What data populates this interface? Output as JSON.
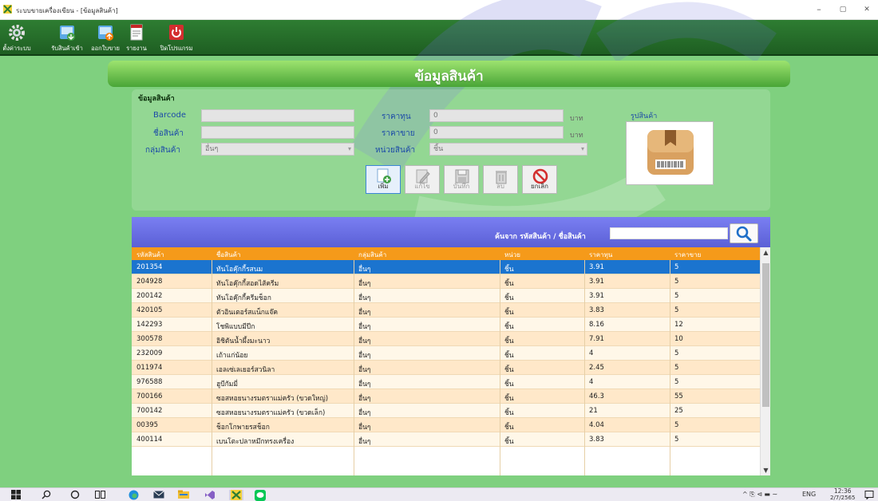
{
  "window": {
    "title": "ระบบขายเครื่องเขียน - [ข้อมูลสินค้า]",
    "minimize": "–",
    "maximize": "▢",
    "close": "✕"
  },
  "toolbar": [
    {
      "label": "ตั้งค่าระบบ",
      "icon": "gear-icon"
    },
    {
      "label": "รับสินค้าเข้า",
      "icon": "receive-goods-icon"
    },
    {
      "label": "ออกใบขาย",
      "icon": "invoice-icon"
    },
    {
      "label": "รายงาน",
      "icon": "report-icon"
    },
    {
      "label": "ปิดโปรแกรม",
      "icon": "power-icon"
    }
  ],
  "page_title": "ข้อมูลสินค้า",
  "form": {
    "section_label": "ข้อมูลสินค้า",
    "barcode_label": "Barcode",
    "barcode_value": "",
    "name_label": "ชื่อสินค้า",
    "name_value": "",
    "group_label": "กลุ่มสินค้า",
    "group_value": "อื่นๆ",
    "cost_label": "ราคาทุน",
    "cost_value": "0",
    "cost_unit": "บาท",
    "price_label": "ราคาขาย",
    "price_value": "0",
    "price_unit": "บาท",
    "unit_label": "หน่วยสินค้า",
    "unit_value": "ชิ้น",
    "photo_label": "รูปสินค้า"
  },
  "actions": {
    "add": "เพิ่ม",
    "edit": "แก้ไข",
    "save": "บันทึก",
    "delete": "ลบ",
    "cancel": "ยกเลิก"
  },
  "search": {
    "label": "ค้นจาก รหัสสินค้า / ชื่อสินค้า",
    "value": ""
  },
  "table": {
    "headers": [
      "รหัสสินค้า",
      "ชื่อสินค้า",
      "กลุ่มสินค้า",
      "หน่วย",
      "ราคาทุน",
      "ราคาขาย"
    ],
    "rows": [
      [
        "201354",
        "ทันโอคุ๊กกี้รสนม",
        "อื่นๆ",
        "ชิ้น",
        "3.91",
        "5"
      ],
      [
        "204928",
        "ทันโอคุ๊กกี้สอดไส้ครีม",
        "อื่นๆ",
        "ชิ้น",
        "3.91",
        "5"
      ],
      [
        "200142",
        "ทันโอคุ๊กกี้ครีมช็อก",
        "อื่นๆ",
        "ชิ้น",
        "3.91",
        "5"
      ],
      [
        "420105",
        "ตัวอินเตอร์สแน็กแจ๊ค",
        "อื่นๆ",
        "ชิ้น",
        "3.83",
        "5"
      ],
      [
        "142293",
        "โชพิแบบมีปีก",
        "อื่นๆ",
        "ชิ้น",
        "8.16",
        "12"
      ],
      [
        "300578",
        "อิชิตันน้ำผึ้งมะนาว",
        "อื่นๆ",
        "ชิ้น",
        "7.91",
        "10"
      ],
      [
        "232009",
        "เถ้าแก่น้อย",
        "อื่นๆ",
        "ชิ้น",
        "4",
        "5"
      ],
      [
        "011974",
        "เอลเซ่เลเยอร์สวนิลา",
        "อื่นๆ",
        "ชิ้น",
        "2.45",
        "5"
      ],
      [
        "976588",
        "ฮูบีกัมมี่",
        "อื่นๆ",
        "ชิ้น",
        "4",
        "5"
      ],
      [
        "700166",
        "ซอสหอยนางรมตราแม่ครัว (ขวดใหญ่)",
        "อื่นๆ",
        "ชิ้น",
        "46.3",
        "55"
      ],
      [
        "700142",
        "ซอสหอยนางรมตราแม่ครัว (ขวดเล็ก)",
        "อื่นๆ",
        "ชิ้น",
        "21",
        "25"
      ],
      [
        "00395",
        "ช็อกโกพายรสช็อก",
        "อื่นๆ",
        "ชิ้น",
        "4.04",
        "5"
      ],
      [
        "400114",
        "เบนโตะปลาหมึกทรงเครื่อง",
        "อื่นๆ",
        "ชิ้น",
        "3.83",
        "5"
      ]
    ]
  },
  "taskbar": {
    "lang": "ENG",
    "time": "12:36",
    "date": "2/7/2565"
  }
}
